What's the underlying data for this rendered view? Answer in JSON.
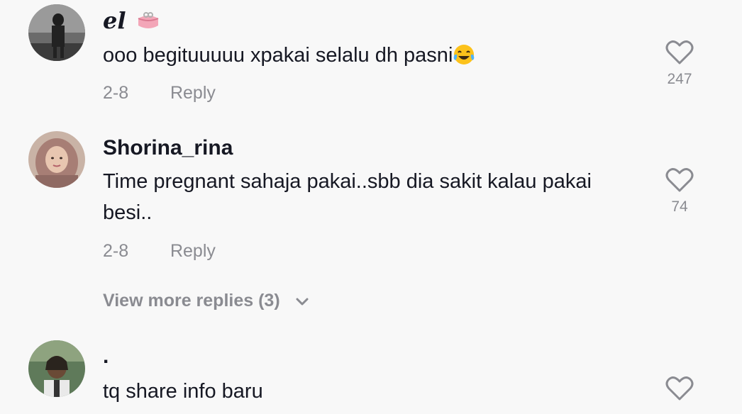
{
  "comments": [
    {
      "username": "el",
      "username_emoji": "purse-icon",
      "text": "ooo begituuuuu xpakai selalu dh pasni",
      "text_emoji": "tears-of-joy-icon",
      "date": "2-8",
      "reply_label": "Reply",
      "likes": "247"
    },
    {
      "username": "Shorina_rina",
      "text": "Time pregnant sahaja pakai..sbb dia sakit kalau pakai besi..",
      "date": "2-8",
      "reply_label": "Reply",
      "likes": "74",
      "view_more_label": "View more replies (3)"
    },
    {
      "username": ".",
      "text": "tq share info baru"
    }
  ],
  "colors": {
    "background": "#f8f8f8",
    "primary_text": "#161823",
    "secondary_text": "#8a8b91"
  }
}
